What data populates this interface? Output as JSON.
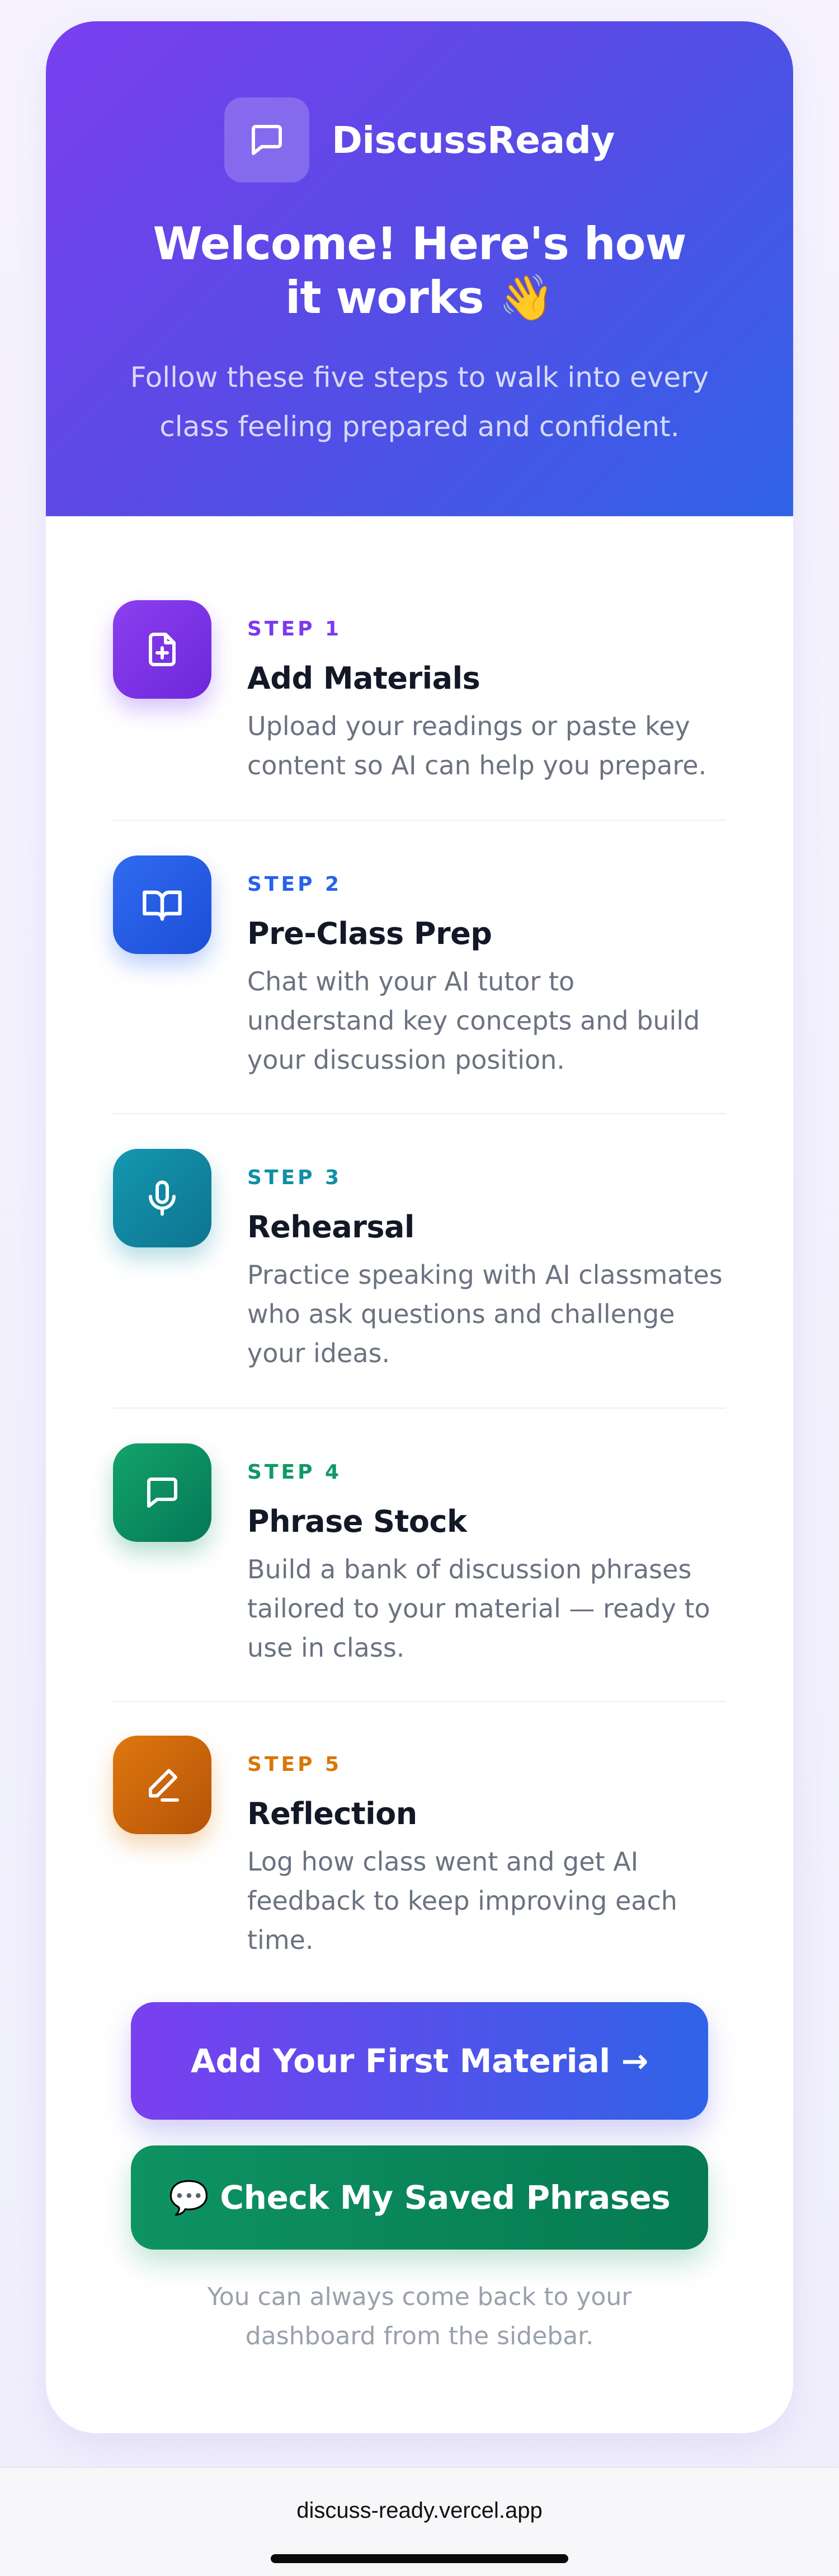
{
  "app": {
    "brand_name": "DiscussReady",
    "title": "Welcome! Here's how it works 👋",
    "subtitle": "Follow these five steps to walk into every class feeling prepared and confident."
  },
  "steps": [
    {
      "kicker": "STEP 1",
      "title": "Add Materials",
      "desc": "Upload your readings or paste key content so AI can help you prepare.",
      "icon": "file-plus-icon",
      "color": "#7c3aed"
    },
    {
      "kicker": "STEP 2",
      "title": "Pre-Class Prep",
      "desc": "Chat with your AI tutor to understand key concepts and build your discussion position.",
      "icon": "book-open-icon",
      "color": "#2563eb"
    },
    {
      "kicker": "STEP 3",
      "title": "Rehearsal",
      "desc": "Practice speaking with AI classmates who ask questions and challenge your ideas.",
      "icon": "microphone-icon",
      "color": "#0e8fa6"
    },
    {
      "kicker": "STEP 4",
      "title": "Phrase Stock",
      "desc": "Build a bank of discussion phrases tailored to your material — ready to use in class.",
      "icon": "chat-bubble-icon",
      "color": "#0f9a63"
    },
    {
      "kicker": "STEP 5",
      "title": "Reflection",
      "desc": "Log how class went and get AI feedback to keep improving each time.",
      "icon": "pen-line-icon",
      "color": "#d97706"
    }
  ],
  "actions": {
    "primary_label": "Add Your First Material →",
    "secondary_label": "💬 Check My Saved Phrases"
  },
  "footer_note": "You can always come back to your dashboard from the sidebar.",
  "browser": {
    "url": "discuss-ready.vercel.app"
  },
  "colors": {
    "hero_start": "#7a3fef",
    "hero_end": "#2f63e7",
    "secondary_button": "#0e9363"
  }
}
